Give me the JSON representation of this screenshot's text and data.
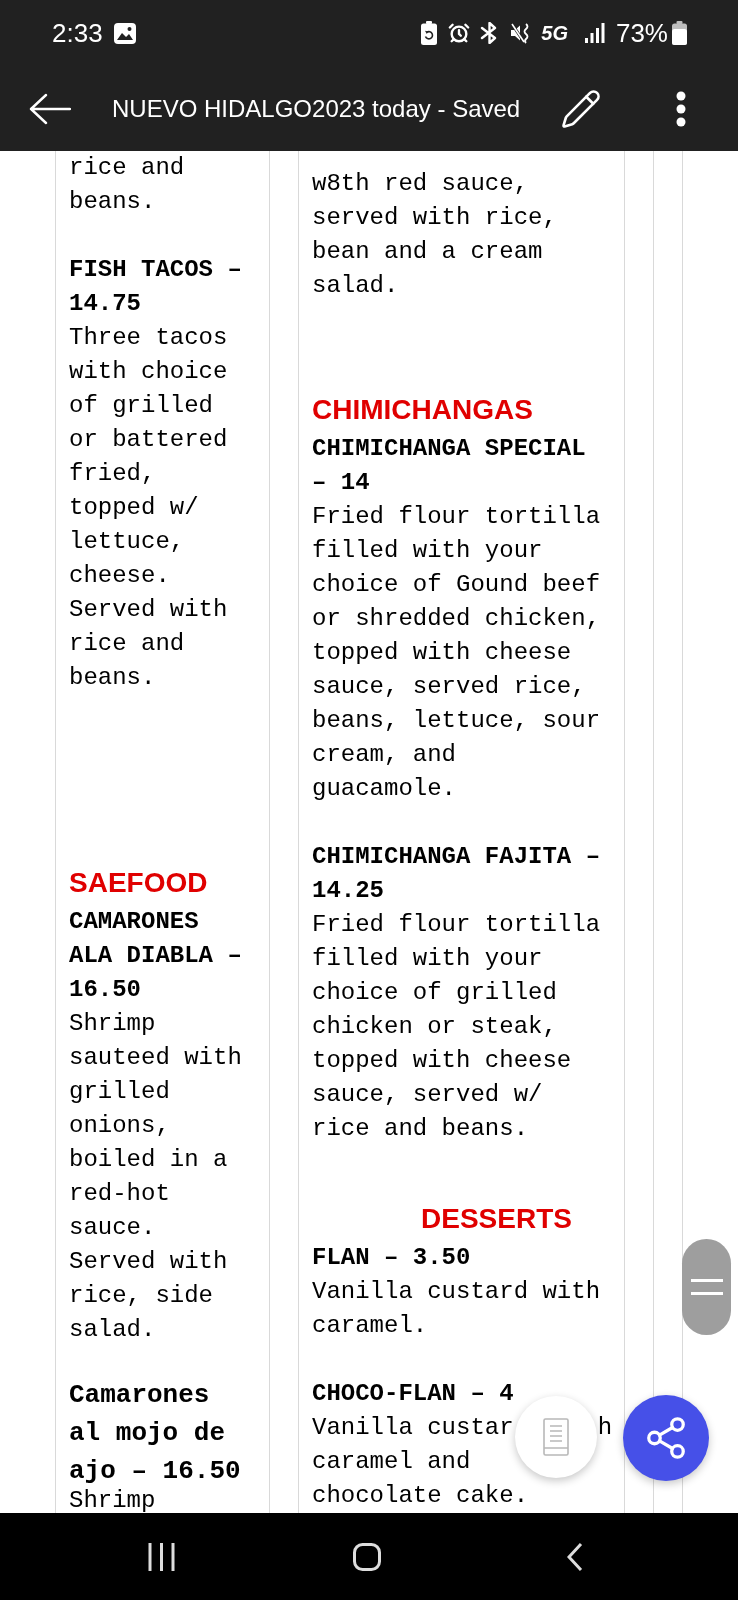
{
  "status_bar": {
    "time": "2:33",
    "network": "5G",
    "battery": "73%"
  },
  "app_bar": {
    "title": "NUEVO HIDALGO2023 today - Saved"
  },
  "document": {
    "columns": [
      {
        "blocks": [
          {
            "kind": "text",
            "text": "rice and beans."
          },
          {
            "kind": "item",
            "name": "FISH TACOS – 14.75",
            "desc": "Three tacos with choice of grilled or battered fried, topped w/ lettuce, cheese. Served with rice and beans."
          },
          {
            "kind": "heading",
            "text": "SAEFOOD"
          },
          {
            "kind": "item",
            "name": "CAMARONES ALA DIABLA – 16.50",
            "desc": "Shrimp sauteed with grilled onions, boiled in a red-hot sauce. Served with rice, side salad."
          },
          {
            "kind": "large_item",
            "name": "Camarones al mojo de ajo – 16.50",
            "desc": "Shrimp"
          }
        ]
      },
      {
        "blocks": [
          {
            "kind": "text",
            "text": "w8th red sauce, served with rice, bean and a cream salad."
          },
          {
            "kind": "heading",
            "text": "CHIMICHANGAS"
          },
          {
            "kind": "item",
            "name": "CHIMICHANGA SPECIAL – 14",
            "desc": "Fried flour tortilla filled with your choice of Gound beef or shredded chicken, topped with cheese sauce, served rice, beans, lettuce, sour cream, and guacamole."
          },
          {
            "kind": "item",
            "name": "CHIMICHANGA FAJITA – 14.25",
            "desc": "Fried flour tortilla filled with your choice of grilled chicken or steak, topped with cheese sauce, served w/ rice and beans."
          },
          {
            "kind": "heading",
            "text": "DESSERTS"
          },
          {
            "kind": "item",
            "name": "FLAN – 3.50",
            "desc": "Vanilla custard with caramel."
          },
          {
            "kind": "item",
            "name": "CHOCO-FLAN – 4",
            "desc_fragments": [
              "Vanilla custar",
              "h",
              "caramel and",
              "chocolate cake."
            ]
          }
        ]
      }
    ]
  }
}
